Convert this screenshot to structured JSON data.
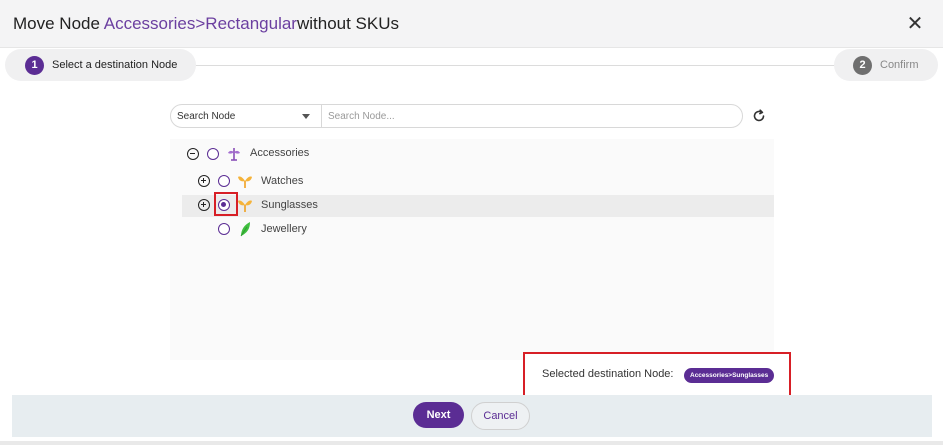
{
  "header": {
    "title_main": "Move Node",
    "title_path": "Accessories>Rectangular",
    "title_tail": "without SKUs",
    "close_glyph": "✕"
  },
  "stepper": {
    "steps": [
      {
        "number": "1",
        "label": "Select a destination Node"
      },
      {
        "number": "2",
        "label": "Confirm"
      }
    ]
  },
  "search": {
    "select_value": "Search Node",
    "input_placeholder": "Search Node...",
    "input_value": "",
    "refresh_icon": "refresh-icon"
  },
  "tree": {
    "nodes": [
      {
        "label": "Accessories",
        "toggle": "collapse",
        "icon": "category-root-icon",
        "selected": false
      },
      {
        "label": "Watches",
        "toggle": "expand",
        "icon": "category-branch-icon",
        "selected": false
      },
      {
        "label": "Sunglasses",
        "toggle": "expand",
        "icon": "category-branch-icon",
        "selected": true
      },
      {
        "label": "Jewellery",
        "toggle": "none",
        "icon": "category-leaf-icon",
        "selected": false
      }
    ]
  },
  "destination": {
    "label": "Selected destination Node:",
    "value": "Accessories>Sunglasses"
  },
  "footer": {
    "next_label": "Next",
    "cancel_label": "Cancel"
  },
  "colors": {
    "accent": "#5b2d94",
    "highlight": "#d71f26",
    "branch_icon": "#f5a623",
    "leaf_icon": "#3fbf3f"
  }
}
